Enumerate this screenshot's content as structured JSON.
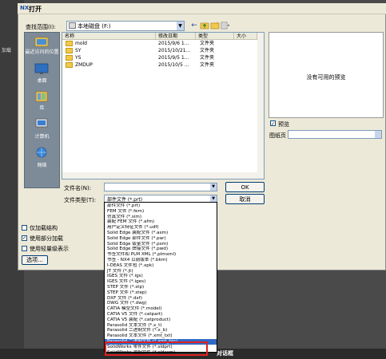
{
  "background": {
    "left_label": "加载",
    "bottom_label": "对话框"
  },
  "dialog": {
    "title": "打开",
    "lookin_label": "查找范围(I):",
    "lookin_value": "本地磁盘 (F:)",
    "toolbar": {
      "back_icon": "back-arrow-icon",
      "up_icon": "up-folder-icon",
      "new_folder_icon": "new-folder-icon",
      "views_icon": "views-menu-icon"
    },
    "places": [
      {
        "label": "最近访问的位置",
        "icon": "recent-places-icon"
      },
      {
        "label": "桌面",
        "icon": "desktop-icon"
      },
      {
        "label": "库",
        "icon": "libraries-icon"
      },
      {
        "label": "计算机",
        "icon": "computer-icon"
      },
      {
        "label": "网络",
        "icon": "network-icon"
      }
    ],
    "columns": {
      "name": "名称",
      "date": "修改日期",
      "type": "类型",
      "size": "大小"
    },
    "files": [
      {
        "name": "mold",
        "date": "2015/9/6 1...",
        "type": "文件夹"
      },
      {
        "name": "SY",
        "date": "2015/10/21...",
        "type": "文件夹"
      },
      {
        "name": "YS",
        "date": "2015/9/5 1...",
        "type": "文件夹"
      },
      {
        "name": "ZMDUP",
        "date": "2015/10/5 ...",
        "type": "文件夹"
      }
    ],
    "preview_text": "没有可用的预览",
    "preview_label": "预览",
    "preview_checked": true,
    "sheet_label": "图纸页",
    "filename_label": "文件名(N):",
    "filename_value": "",
    "filetype_label": "文件类型(T):",
    "filetype_value": "部件文件 (*.prt)",
    "ok_label": "OK",
    "cancel_label": "取消",
    "checkboxes": [
      {
        "label": "仅加载结构",
        "checked": false
      },
      {
        "label": "使用部分加载",
        "checked": true
      },
      {
        "label": "使用轻量级表示",
        "checked": false
      }
    ],
    "options_label": "选项..."
  },
  "dropdown": {
    "options": [
      "部件文件 (*.prt)",
      "FEM 文件 (*.fem)",
      "仿真文件 (*.sim)",
      "装配 FEM 文件 (*.afm)",
      "用户定义特征文件 (*.udf)",
      "Solid Edge 装配文件 (*.asm)",
      "Solid Edge 部件文件 (*.par)",
      "Solid Edge 钣金文件 (*.psm)",
      "Solid Edge 焊接文件 (*.pwd)",
      "书签文件和 PLM XML (*.plmxml)",
      "书签 - NX4 以前版本 (*.bkm)",
      "I-DEAS 文件包 (*.xpk)",
      "JT 文件 (*.jt)",
      "IGES 文件 (*.igs)",
      "IGES 文件 (*.iges)",
      "STEP 文件 (*.stp)",
      "STEP 文件 (*.step)",
      "DXF 文件 (*.dxf)",
      "DWG 文件 (*.dwg)",
      "CATIA 模型文件 (*.model)",
      "CATIA V5 文件 (*.catpart)",
      "CATIA V5 装配 (*.catproduct)",
      "Parasolid 文本文件 (*.x_t)",
      "Parasolid 二进制文件 (*.x_b)",
      "Parasolid 文本文件 (*.xmt_txt)",
      "Parasolid 二进制文件 (*.xmt_bin)",
      "SolidWorks 零件文件 (*.sldprt)",
      "SolidWorks 装配文件 (*.sldasm)"
    ],
    "selected_index": 25
  },
  "colors": {
    "selection": "#316ac5",
    "highlight_box": "#e02020"
  }
}
